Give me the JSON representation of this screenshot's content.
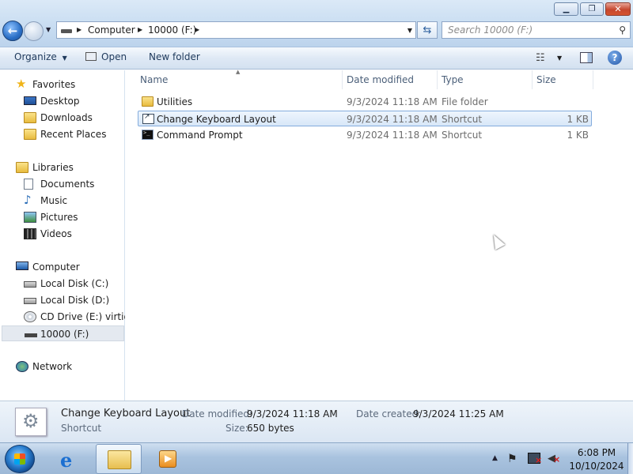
{
  "address_bar": {
    "crumbs": [
      "Computer",
      "10000 (F:)"
    ],
    "search_placeholder": "Search 10000 (F:)"
  },
  "toolbar": {
    "organize_label": "Organize",
    "open_label": "Open",
    "new_folder_label": "New folder"
  },
  "navigation": {
    "favorites": {
      "label": "Favorites",
      "items": [
        "Desktop",
        "Downloads",
        "Recent Places"
      ]
    },
    "libraries": {
      "label": "Libraries",
      "items": [
        "Documents",
        "Music",
        "Pictures",
        "Videos"
      ]
    },
    "computer": {
      "label": "Computer",
      "items": [
        "Local Disk (C:)",
        "Local Disk (D:)",
        "CD Drive (E:) virtio-w",
        "10000 (F:)"
      ],
      "selected": "10000 (F:)"
    },
    "network": {
      "label": "Network"
    }
  },
  "file_list": {
    "columns": [
      "Name",
      "Date modified",
      "Type",
      "Size"
    ],
    "rows": [
      {
        "name": "Utilities",
        "date_modified": "9/3/2024 11:18 AM",
        "type": "File folder",
        "size": "",
        "icon": "folder-icon"
      },
      {
        "name": "Change Keyboard Layout",
        "date_modified": "9/3/2024 11:18 AM",
        "type": "Shortcut",
        "size": "1 KB",
        "icon": "shortcut-icon",
        "selected": true
      },
      {
        "name": "Command Prompt",
        "date_modified": "9/3/2024 11:18 AM",
        "type": "Shortcut",
        "size": "1 KB",
        "icon": "command-prompt-icon"
      }
    ]
  },
  "details_pane": {
    "name": "Change Keyboard Layout",
    "type": "Shortcut",
    "date_modified_label": "Date modified:",
    "date_modified_value": "9/3/2024 11:18 AM",
    "size_label": "Size:",
    "size_value": "650 bytes",
    "date_created_label": "Date created:",
    "date_created_value": "9/3/2024 11:25 AM"
  },
  "taskbar": {
    "pinned": [
      "internet-explorer-icon",
      "windows-explorer-icon",
      "media-player-icon"
    ],
    "active": "windows-explorer-icon",
    "clock_time": "6:08 PM",
    "clock_date": "10/10/2024"
  }
}
